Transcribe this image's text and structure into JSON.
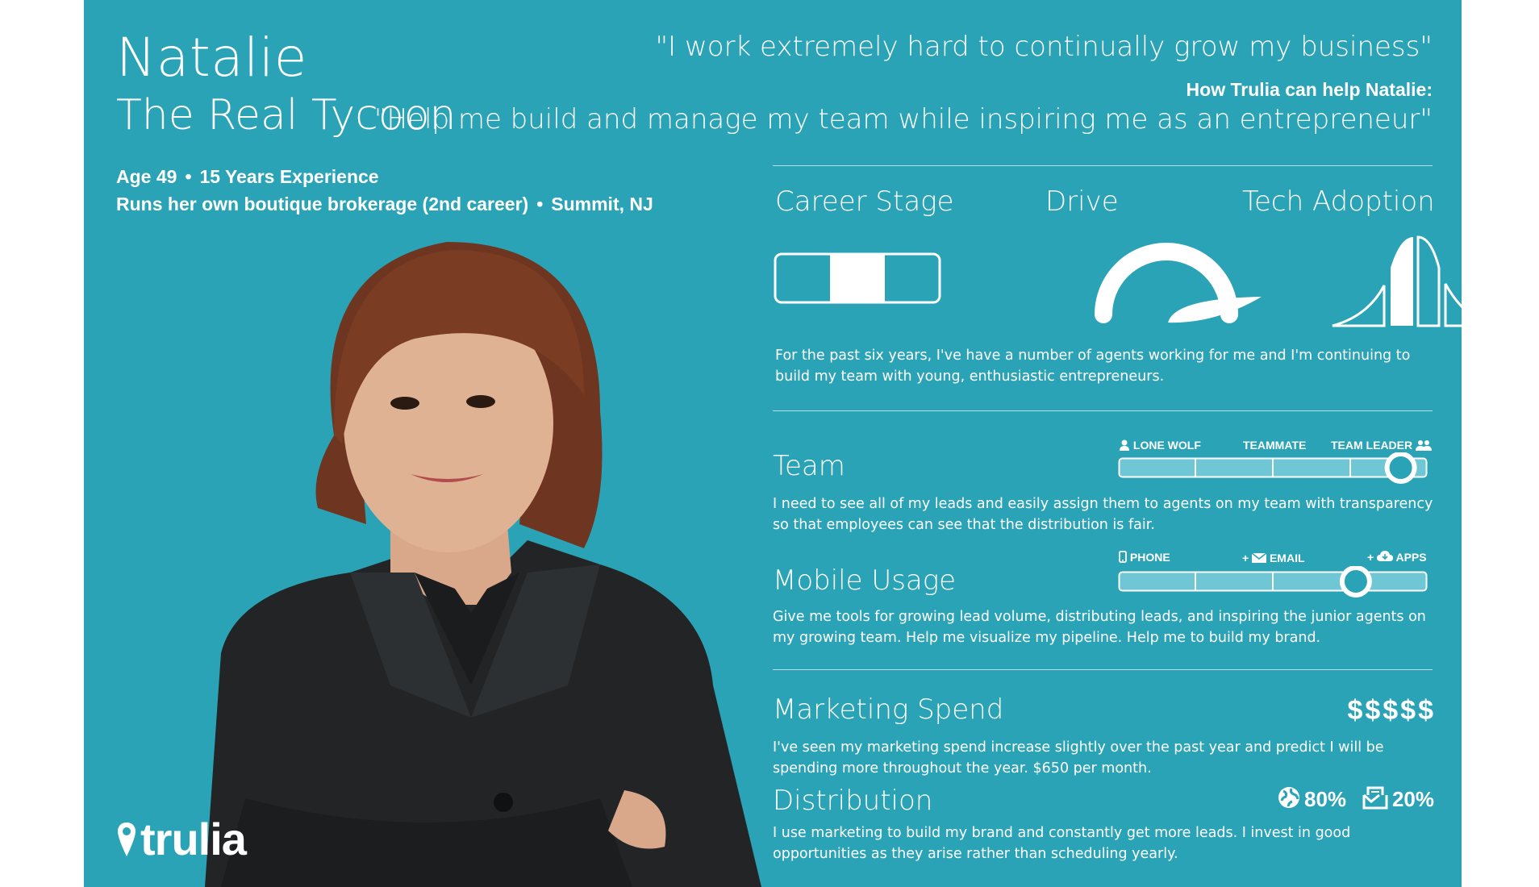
{
  "persona": {
    "name": "Natalie",
    "title": "The Real Tycoon",
    "age": "Age 49",
    "experience": "15 Years Experience",
    "occupation": "Runs her own boutique brokerage (2nd career)",
    "location": "Summit, NJ"
  },
  "quotes": {
    "motto": "\"I work extremely hard to continually grow my business\"",
    "help_label": "How Trulia can help Natalie:",
    "help_quote": "\"Help me build and manage my team while inspiring me as an entrepreneur\""
  },
  "stages": {
    "career_label": "Career Stage",
    "drive_label": "Drive",
    "tech_label": "Tech Adoption",
    "career_segment": 2,
    "career_segments_total": 3,
    "description": "For the past six years, I've have a number of agents working for me and I'm continuing to build my team with young, enthusiastic entrepreneurs."
  },
  "team": {
    "title": "Team",
    "labels": [
      "LONE WOLF",
      "TEAMMATE",
      "TEAM LEADER"
    ],
    "level": 0.95,
    "description": "I need to see all of my leads and easily assign them to agents on my team with transparency so that employees can see that the distribution is fair."
  },
  "mobile": {
    "title": "Mobile Usage",
    "labels": [
      "PHONE",
      "+ ",
      "EMAIL",
      "+ ",
      "APPS"
    ],
    "level": 0.79,
    "description": "Give me tools for growing lead volume, distributing leads, and inspiring the junior agents on my growing team. Help me visualize my pipeline. Help me to build my brand."
  },
  "marketing": {
    "title": "Marketing Spend",
    "dollars": "$$$$$",
    "description": "I've seen my marketing spend increase slightly over the past year and predict I will be spending more throughout the year. $650 per month."
  },
  "distribution": {
    "title": "Distribution",
    "online_pct": "80%",
    "print_pct": "20%",
    "description": "I use marketing to build my brand and constantly get more leads. I invest in good opportunities as they arise rather than scheduling yearly."
  },
  "brand": {
    "logo": "trulia"
  },
  "colors": {
    "background": "#2ba3b7",
    "foreground": "#ffffff",
    "track": "#6fc6d4"
  },
  "icons": [
    "user-icon",
    "users-icon",
    "phone-icon",
    "email-icon",
    "cloud-icon",
    "globe-icon",
    "print-icon",
    "map-pin-icon"
  ]
}
